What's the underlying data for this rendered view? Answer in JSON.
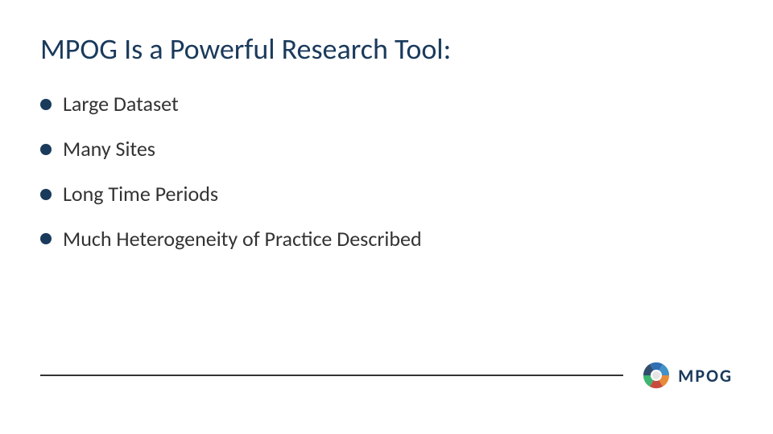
{
  "slide": {
    "title": "MPOG Is a Powerful Research Tool:",
    "bullets": [
      {
        "text": "Large Dataset"
      },
      {
        "text": "Many Sites"
      },
      {
        "text": "Long Time Periods"
      },
      {
        "text": "Much Heterogeneity of Practice Described"
      }
    ],
    "logo": {
      "text": "MPOG",
      "icon_label": "mpog-logo-icon"
    }
  }
}
